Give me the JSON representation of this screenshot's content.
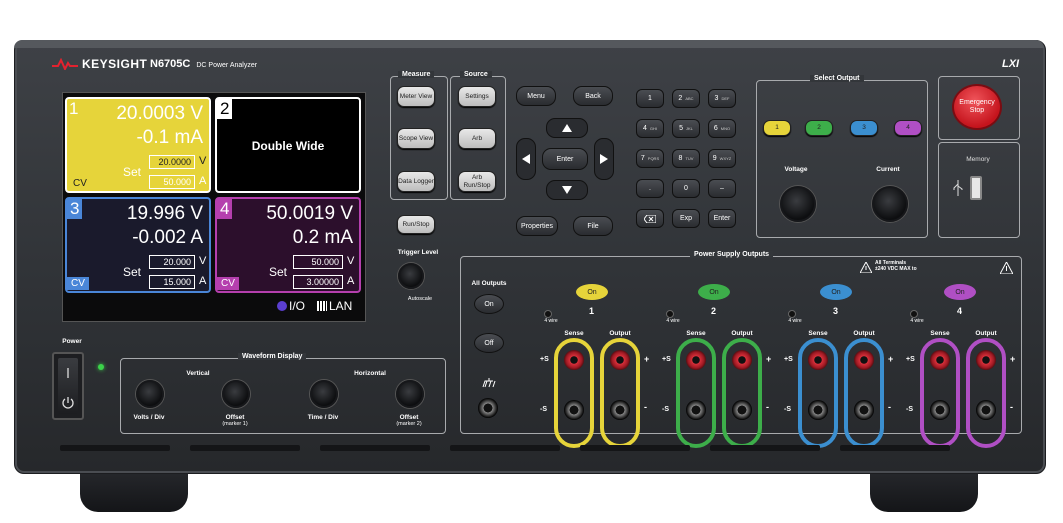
{
  "brand": {
    "name": "KEYSIGHT",
    "model": "N6705C",
    "subtitle": "DC Power Analyzer",
    "lxi": "LXI"
  },
  "display": {
    "ch1": {
      "num": "1",
      "voltage": "20.0003 V",
      "current": "-0.1 mA",
      "set_label": "Set",
      "set_v": "20.0000",
      "set_a": "50.000",
      "unit_v": "V",
      "unit_a": "A",
      "mode": "CV",
      "color": "#e6d43a"
    },
    "ch2": {
      "num": "2",
      "text": "Double Wide"
    },
    "ch3": {
      "num": "3",
      "voltage": "19.996 V",
      "current": "-0.002 A",
      "set_label": "Set",
      "set_v": "20.000",
      "set_a": "15.000",
      "unit_v": "V",
      "unit_a": "A",
      "mode": "CV",
      "color": "#4a86d8"
    },
    "ch4": {
      "num": "4",
      "voltage": "50.0019 V",
      "current": "0.2 mA",
      "set_label": "Set",
      "set_v": "50.000",
      "set_a": "3.00000",
      "unit_v": "V",
      "unit_a": "A",
      "mode": "CV",
      "color": "#b53fae"
    },
    "status": {
      "io": "I/O",
      "lan": "LAN"
    }
  },
  "measure": {
    "title": "Measure",
    "meter": "Meter View",
    "scope": "Scope View",
    "logger": "Data Logger"
  },
  "source": {
    "title": "Source",
    "settings": "Settings",
    "arb": "Arb",
    "arb_run": "Arb Run/Stop"
  },
  "controls": {
    "menu": "Menu",
    "back": "Back",
    "enter": "Enter",
    "properties": "Properties",
    "file": "File",
    "run_stop": "Run/Stop",
    "trigger_level": "Trigger Level",
    "autoscale": "Autoscale"
  },
  "keypad": {
    "keys": [
      {
        "k": "1",
        "s": ""
      },
      {
        "k": "2",
        "s": "ABC"
      },
      {
        "k": "3",
        "s": "DEF"
      },
      {
        "k": "4",
        "s": "GHI"
      },
      {
        "k": "5",
        "s": "JKL"
      },
      {
        "k": "6",
        "s": "MNO"
      },
      {
        "k": "7",
        "s": "PQRS"
      },
      {
        "k": "8",
        "s": "TUV"
      },
      {
        "k": "9",
        "s": "WXYZ"
      },
      {
        "k": ".",
        "s": ""
      },
      {
        "k": "0",
        "s": ""
      },
      {
        "k": "–",
        "s": ""
      }
    ],
    "exp": "Exp",
    "enter": "Enter"
  },
  "select_output": {
    "title": "Select Output",
    "buttons": [
      {
        "label": "1",
        "color": "#e6d43a"
      },
      {
        "label": "2",
        "color": "#3dae4a"
      },
      {
        "label": "3",
        "color": "#3b8fd0"
      },
      {
        "label": "4",
        "color": "#b04fc4"
      }
    ],
    "voltage": "Voltage",
    "current": "Current"
  },
  "emergency": {
    "line1": "Emergency",
    "line2": "Stop"
  },
  "memory": "Memory",
  "power": "Power",
  "waveform": {
    "title": "Waveform Display",
    "vertical": "Vertical",
    "horizontal": "Horizontal",
    "volts_div": "Volts / Div",
    "offset1": "Offset",
    "marker1": "(marker 1)",
    "time_div": "Time / Div",
    "offset2": "Offset",
    "marker2": "(marker 2)"
  },
  "outputs": {
    "title": "Power Supply Outputs",
    "warning": "All Terminals",
    "warning2": "±240 VDC MAX to",
    "all_outputs": "All Outputs",
    "on": "On",
    "off": "Off",
    "four_wire": "4 wire",
    "sense": "Sense",
    "output": "Output",
    "plus_s": "+S",
    "minus_s": "-S",
    "plus": "+",
    "minus": "-",
    "channels": [
      {
        "num": "1",
        "color": "#e6d43a"
      },
      {
        "num": "2",
        "color": "#3dae4a"
      },
      {
        "num": "3",
        "color": "#3b8fd0"
      },
      {
        "num": "4",
        "color": "#b04fc4"
      }
    ]
  }
}
